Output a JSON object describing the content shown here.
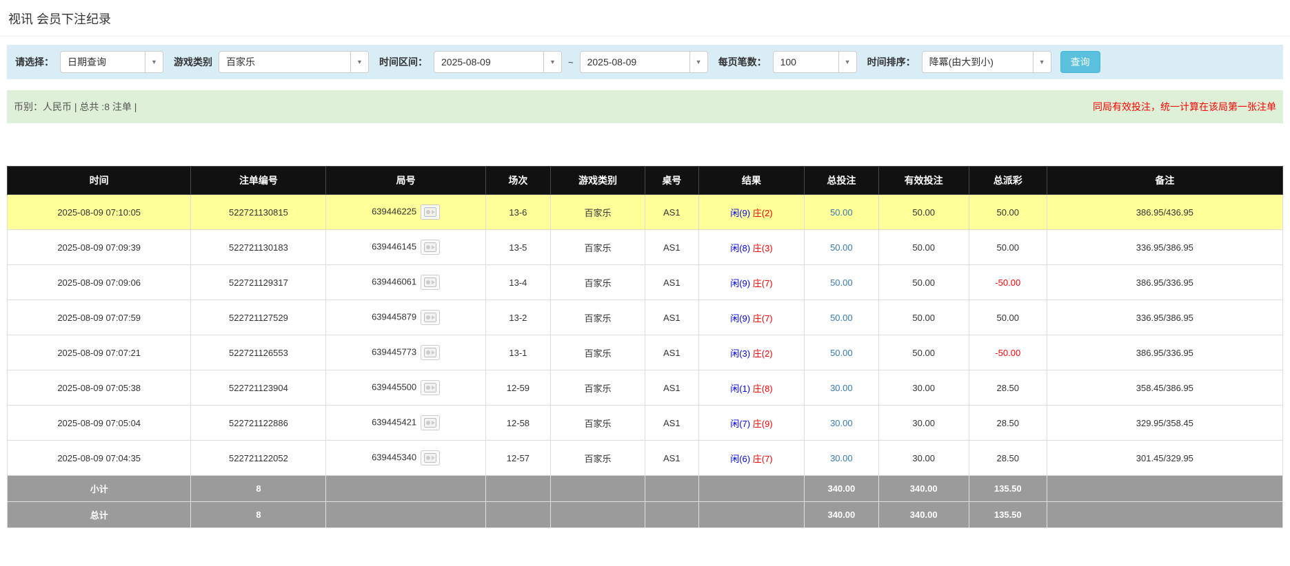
{
  "page": {
    "title": "视讯 会员下注纪录"
  },
  "filters": {
    "select_label": "请选择：",
    "select_value": "日期查询",
    "game_type_label": "游戏类别",
    "game_type_value": "百家乐",
    "date_range_label": "时间区间：",
    "date_from": "2025-08-09",
    "tilde": "~",
    "date_to": "2025-08-09",
    "per_page_label": "每页笔数：",
    "per_page_value": "100",
    "sort_label": "时间排序：",
    "sort_value": "降冪(由大到小)",
    "search_button": "查询"
  },
  "summary": {
    "left": "币别：人民币 | 总共 :8 注单 |",
    "right": "同局有效投注，统一计算在该局第一张注单"
  },
  "table": {
    "headers": [
      "时间",
      "注单编号",
      "局号",
      "场次",
      "游戏类别",
      "桌号",
      "结果",
      "总投注",
      "有效投注",
      "总派彩",
      "备注"
    ],
    "rows": [
      {
        "time": "2025-08-09 07:10:05",
        "bet_id": "522721130815",
        "round_id": "639446225",
        "session": "13-6",
        "game": "百家乐",
        "table_no": "AS1",
        "result_player": "闲(9)",
        "result_banker": "庄(2)",
        "total_bet": "50.00",
        "valid_bet": "50.00",
        "payout": "50.00",
        "remark": "386.95/436.95",
        "highlighted": true
      },
      {
        "time": "2025-08-09 07:09:39",
        "bet_id": "522721130183",
        "round_id": "639446145",
        "session": "13-5",
        "game": "百家乐",
        "table_no": "AS1",
        "result_player": "闲(8)",
        "result_banker": "庄(3)",
        "total_bet": "50.00",
        "valid_bet": "50.00",
        "payout": "50.00",
        "remark": "336.95/386.95",
        "highlighted": false
      },
      {
        "time": "2025-08-09 07:09:06",
        "bet_id": "522721129317",
        "round_id": "639446061",
        "session": "13-4",
        "game": "百家乐",
        "table_no": "AS1",
        "result_player": "闲(9)",
        "result_banker": "庄(7)",
        "total_bet": "50.00",
        "valid_bet": "50.00",
        "payout": "-50.00",
        "remark": "386.95/336.95",
        "highlighted": false
      },
      {
        "time": "2025-08-09 07:07:59",
        "bet_id": "522721127529",
        "round_id": "639445879",
        "session": "13-2",
        "game": "百家乐",
        "table_no": "AS1",
        "result_player": "闲(9)",
        "result_banker": "庄(7)",
        "total_bet": "50.00",
        "valid_bet": "50.00",
        "payout": "50.00",
        "remark": "336.95/386.95",
        "highlighted": false
      },
      {
        "time": "2025-08-09 07:07:21",
        "bet_id": "522721126553",
        "round_id": "639445773",
        "session": "13-1",
        "game": "百家乐",
        "table_no": "AS1",
        "result_player": "闲(3)",
        "result_banker": "庄(2)",
        "total_bet": "50.00",
        "valid_bet": "50.00",
        "payout": "-50.00",
        "remark": "386.95/336.95",
        "highlighted": false
      },
      {
        "time": "2025-08-09 07:05:38",
        "bet_id": "522721123904",
        "round_id": "639445500",
        "session": "12-59",
        "game": "百家乐",
        "table_no": "AS1",
        "result_player": "闲(1)",
        "result_banker": "庄(8)",
        "total_bet": "30.00",
        "valid_bet": "30.00",
        "payout": "28.50",
        "remark": "358.45/386.95",
        "highlighted": false
      },
      {
        "time": "2025-08-09 07:05:04",
        "bet_id": "522721122886",
        "round_id": "639445421",
        "session": "12-58",
        "game": "百家乐",
        "table_no": "AS1",
        "result_player": "闲(7)",
        "result_banker": "庄(9)",
        "total_bet": "30.00",
        "valid_bet": "30.00",
        "payout": "28.50",
        "remark": "329.95/358.45",
        "highlighted": false
      },
      {
        "time": "2025-08-09 07:04:35",
        "bet_id": "522721122052",
        "round_id": "639445340",
        "session": "12-57",
        "game": "百家乐",
        "table_no": "AS1",
        "result_player": "闲(6)",
        "result_banker": "庄(7)",
        "total_bet": "30.00",
        "valid_bet": "30.00",
        "payout": "28.50",
        "remark": "301.45/329.95",
        "highlighted": false
      }
    ],
    "subtotal": {
      "label": "小计",
      "count": "8",
      "total_bet": "340.00",
      "valid_bet": "340.00",
      "payout": "135.50"
    },
    "total": {
      "label": "总计",
      "count": "8",
      "total_bet": "340.00",
      "valid_bet": "340.00",
      "payout": "135.50"
    }
  },
  "colors": {
    "accent": "#5bc0de",
    "highlight": "#ffff99",
    "negative": "#ff0000",
    "link": "#337ab7",
    "player": "#0000ee",
    "banker": "#ee0000",
    "filter-bg": "#d9edf7",
    "summary-bg": "#dff0d8",
    "header-bg": "#111111",
    "footer-bg": "#9b9b9b"
  }
}
